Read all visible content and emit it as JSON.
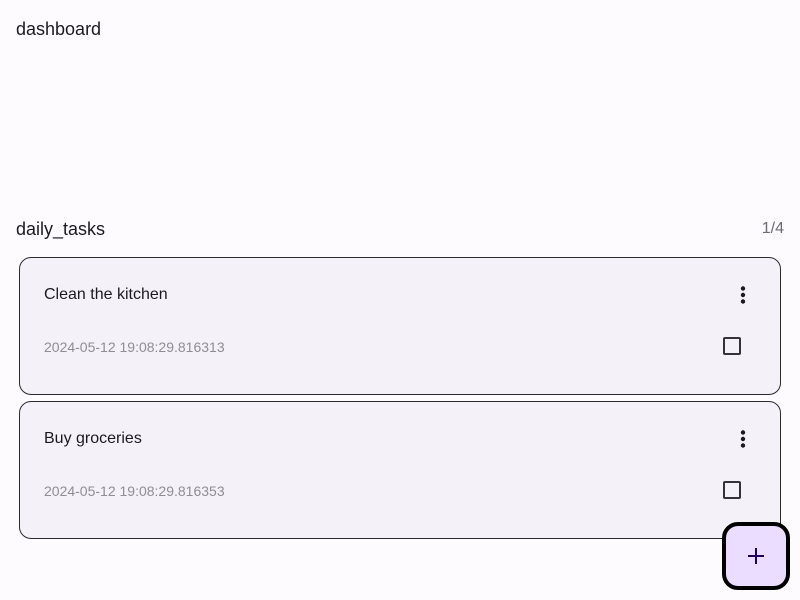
{
  "page": {
    "title": "dashboard"
  },
  "section": {
    "title": "daily_tasks",
    "counter": "1/4"
  },
  "tasks": [
    {
      "title": "Clean the kitchen",
      "timestamp": "2024-05-12 19:08:29.816313",
      "checked": false,
      "menu_icon": "more-vert-icon"
    },
    {
      "title": "Buy groceries",
      "timestamp": "2024-05-12 19:08:29.816353",
      "checked": false,
      "menu_icon": "more-vert-icon"
    }
  ],
  "fab": {
    "icon": "plus-icon"
  },
  "colors": {
    "background": "#fefbff",
    "card_background": "#f4f1f8",
    "fab_background": "#eaddff",
    "timestamp_text": "#8e8e94"
  }
}
